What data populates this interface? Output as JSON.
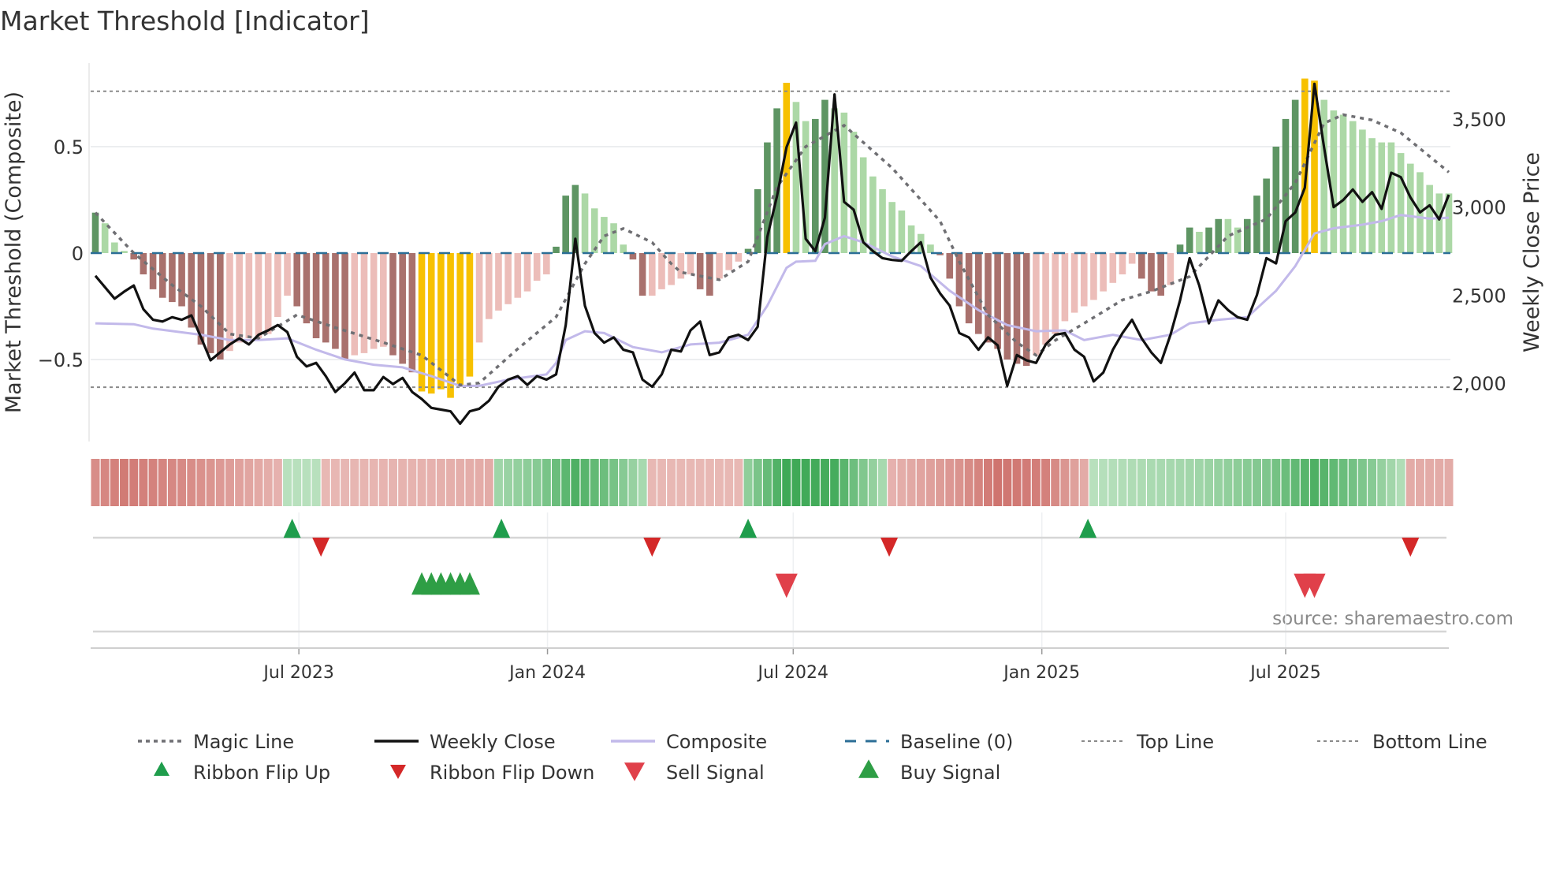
{
  "chart_data": {
    "type": "bar",
    "title": "Market Threshold [Indicator]",
    "ylabel": "Market Threshold (Composite)",
    "y2label": "Weekly Close Price",
    "ylim": [
      -0.75,
      0.85
    ],
    "y2lim": [
      1700,
      3900
    ],
    "yticks": [
      {
        "v": 0.5,
        "label": "0.5"
      },
      {
        "v": 0,
        "label": "0"
      },
      {
        "v": -0.5,
        "label": "−0.5"
      }
    ],
    "y2ticks": [
      {
        "v": 3500,
        "label": "3,500"
      },
      {
        "v": 3000,
        "label": "3,000"
      },
      {
        "v": 2500,
        "label": "2,500"
      },
      {
        "v": 2000,
        "label": "2,000"
      }
    ],
    "xticks": [
      {
        "week": 21.2,
        "label": "Jul 2023"
      },
      {
        "week": 47.1,
        "label": "Jan 2024"
      },
      {
        "week": 72.7,
        "label": "Jul 2024"
      },
      {
        "week": 98.6,
        "label": "Jan 2025"
      },
      {
        "week": 124,
        "label": "Jul 2025"
      }
    ],
    "top_line": 0.76,
    "bottom_line": -0.63,
    "baseline": 0,
    "composite_bars": [
      0.19,
      0.14,
      0.05,
      0.01,
      -0.03,
      -0.1,
      -0.17,
      -0.21,
      -0.23,
      -0.25,
      -0.35,
      -0.43,
      -0.47,
      -0.5,
      -0.46,
      -0.42,
      -0.4,
      -0.4,
      -0.38,
      -0.3,
      -0.2,
      -0.25,
      -0.33,
      -0.4,
      -0.42,
      -0.45,
      -0.5,
      -0.48,
      -0.47,
      -0.45,
      -0.44,
      -0.48,
      -0.52,
      -0.56,
      -0.65,
      -0.66,
      -0.64,
      -0.68,
      -0.62,
      -0.58,
      -0.42,
      -0.31,
      -0.27,
      -0.24,
      -0.21,
      -0.18,
      -0.13,
      -0.1,
      0.03,
      0.27,
      0.32,
      0.28,
      0.21,
      0.17,
      0.14,
      0.04,
      -0.03,
      -0.2,
      -0.2,
      -0.17,
      -0.15,
      -0.12,
      -0.1,
      -0.17,
      -0.2,
      -0.12,
      -0.08,
      -0.04,
      0.02,
      0.3,
      0.52,
      0.68,
      0.8,
      0.71,
      0.62,
      0.63,
      0.72,
      0.68,
      0.66,
      0.57,
      0.45,
      0.36,
      0.3,
      0.24,
      0.2,
      0.13,
      0.09,
      0.04,
      -0.01,
      -0.12,
      -0.25,
      -0.33,
      -0.38,
      -0.42,
      -0.45,
      -0.5,
      -0.52,
      -0.53,
      -0.48,
      -0.43,
      -0.38,
      -0.32,
      -0.28,
      -0.25,
      -0.22,
      -0.18,
      -0.14,
      -0.1,
      -0.05,
      -0.12,
      -0.18,
      -0.2,
      -0.15,
      0.04,
      0.12,
      0.1,
      0.12,
      0.16,
      0.16,
      0.12,
      0.16,
      0.27,
      0.35,
      0.5,
      0.63,
      0.72,
      0.82,
      0.81,
      0.72,
      0.67,
      0.65,
      0.62,
      0.58,
      0.54,
      0.52,
      0.52,
      0.47,
      0.42,
      0.38,
      0.32,
      0.28,
      0.28
    ],
    "weekly_close": [
      2610,
      2545,
      2480,
      2520,
      2555,
      2420,
      2360,
      2350,
      2375,
      2360,
      2385,
      2260,
      2130,
      2175,
      2220,
      2255,
      2220,
      2275,
      2300,
      2330,
      2290,
      2150,
      2095,
      2115,
      2040,
      1950,
      2000,
      2060,
      1960,
      1960,
      2035,
      1995,
      2030,
      1950,
      1910,
      1860,
      1850,
      1840,
      1770,
      1840,
      1855,
      1900,
      1980,
      2020,
      2040,
      1990,
      2040,
      2020,
      2050,
      2330,
      2820,
      2440,
      2285,
      2230,
      2260,
      2190,
      2175,
      2020,
      1980,
      2050,
      2190,
      2180,
      2300,
      2350,
      2160,
      2175,
      2260,
      2275,
      2245,
      2320,
      2830,
      3060,
      3340,
      3480,
      2820,
      2750,
      2940,
      3640,
      3030,
      2985,
      2800,
      2750,
      2710,
      2700,
      2695,
      2750,
      2800,
      2600,
      2510,
      2440,
      2285,
      2260,
      2190,
      2260,
      2215,
      1985,
      2160,
      2130,
      2115,
      2220,
      2275,
      2285,
      2190,
      2150,
      2010,
      2060,
      2190,
      2285,
      2360,
      2255,
      2175,
      2115,
      2275,
      2470,
      2710,
      2555,
      2340,
      2470,
      2415,
      2375,
      2360,
      2500,
      2710,
      2680,
      2920,
      2970,
      3110,
      3700,
      3340,
      3000,
      3040,
      3100,
      3030,
      3085,
      2990,
      3195,
      3170,
      3055,
      2970,
      3010,
      2930,
      3070
    ],
    "composite_line": [
      [
        0,
        2340
      ],
      [
        4,
        2335
      ],
      [
        6,
        2310
      ],
      [
        11,
        2275
      ],
      [
        14,
        2245
      ],
      [
        17,
        2245
      ],
      [
        20,
        2255
      ],
      [
        23,
        2190
      ],
      [
        26,
        2135
      ],
      [
        29,
        2105
      ],
      [
        32,
        2090
      ],
      [
        35,
        2040
      ],
      [
        38,
        1985
      ],
      [
        40,
        1985
      ],
      [
        43,
        2020
      ],
      [
        47,
        2050
      ],
      [
        48,
        2115
      ],
      [
        49,
        2245
      ],
      [
        51,
        2295
      ],
      [
        53,
        2285
      ],
      [
        56,
        2205
      ],
      [
        59,
        2175
      ],
      [
        62,
        2220
      ],
      [
        65,
        2230
      ],
      [
        68,
        2275
      ],
      [
        70,
        2440
      ],
      [
        72,
        2655
      ],
      [
        73,
        2690
      ],
      [
        75,
        2695
      ],
      [
        76,
        2790
      ],
      [
        78,
        2835
      ],
      [
        80,
        2800
      ],
      [
        83,
        2720
      ],
      [
        86,
        2665
      ],
      [
        89,
        2525
      ],
      [
        92,
        2415
      ],
      [
        95,
        2330
      ],
      [
        98,
        2295
      ],
      [
        101,
        2300
      ],
      [
        103,
        2245
      ],
      [
        106,
        2275
      ],
      [
        109,
        2245
      ],
      [
        112,
        2275
      ],
      [
        114,
        2340
      ],
      [
        117,
        2360
      ],
      [
        120,
        2375
      ],
      [
        123,
        2525
      ],
      [
        125,
        2665
      ],
      [
        127,
        2850
      ],
      [
        129,
        2880
      ],
      [
        132,
        2900
      ],
      [
        134,
        2920
      ],
      [
        136,
        2955
      ],
      [
        139,
        2935
      ],
      [
        141,
        2940
      ]
    ],
    "magic_line": [
      [
        0,
        0.19
      ],
      [
        4,
        0
      ],
      [
        8,
        -0.15
      ],
      [
        11,
        -0.25
      ],
      [
        14,
        -0.38
      ],
      [
        17,
        -0.4
      ],
      [
        21,
        -0.29
      ],
      [
        25,
        -0.35
      ],
      [
        30,
        -0.42
      ],
      [
        34,
        -0.48
      ],
      [
        38,
        -0.62
      ],
      [
        40,
        -0.61
      ],
      [
        44,
        -0.45
      ],
      [
        48,
        -0.3
      ],
      [
        51,
        -0.05
      ],
      [
        53,
        0.08
      ],
      [
        55,
        0.115
      ],
      [
        58,
        0.05
      ],
      [
        60,
        -0.05
      ],
      [
        61,
        -0.09
      ],
      [
        65,
        -0.125
      ],
      [
        68,
        -0.04
      ],
      [
        71,
        0.31
      ],
      [
        74,
        0.5
      ],
      [
        78,
        0.6
      ],
      [
        83,
        0.4
      ],
      [
        88,
        0.15
      ],
      [
        90,
        -0.04
      ],
      [
        93,
        -0.29
      ],
      [
        96,
        -0.42
      ],
      [
        98,
        -0.48
      ],
      [
        100,
        -0.41
      ],
      [
        103,
        -0.33
      ],
      [
        107,
        -0.22
      ],
      [
        110,
        -0.18
      ],
      [
        114,
        -0.11
      ],
      [
        118,
        0.08
      ],
      [
        122,
        0.16
      ],
      [
        125,
        0.33
      ],
      [
        128,
        0.61
      ],
      [
        130,
        0.65
      ],
      [
        133,
        0.625
      ],
      [
        136,
        0.565
      ],
      [
        141,
        0.38
      ]
    ],
    "ribbon_strength": [
      [
        0,
        -0.6
      ],
      [
        3,
        -0.75
      ],
      [
        10,
        -0.6
      ],
      [
        19,
        -0.3
      ],
      [
        20,
        0.2
      ],
      [
        23,
        0.2
      ],
      [
        24,
        -0.25
      ],
      [
        35,
        -0.3
      ],
      [
        41,
        -0.35
      ],
      [
        42,
        0.35
      ],
      [
        46,
        0.5
      ],
      [
        50,
        0.85
      ],
      [
        54,
        0.6
      ],
      [
        57,
        0.3
      ],
      [
        58,
        -0.25
      ],
      [
        67,
        -0.25
      ],
      [
        68,
        0.45
      ],
      [
        72,
        0.95
      ],
      [
        77,
        0.9
      ],
      [
        82,
        0.3
      ],
      [
        83,
        -0.3
      ],
      [
        90,
        -0.55
      ],
      [
        94,
        -0.8
      ],
      [
        99,
        -0.7
      ],
      [
        103,
        -0.35
      ],
      [
        104,
        0.2
      ],
      [
        115,
        0.35
      ],
      [
        122,
        0.55
      ],
      [
        127,
        0.85
      ],
      [
        133,
        0.5
      ],
      [
        136,
        0.25
      ],
      [
        137,
        -0.35
      ],
      [
        141,
        -0.35
      ]
    ],
    "ribbon_flip_up": [
      20.5,
      42.3,
      68,
      103.4
    ],
    "ribbon_flip_down": [
      23.5,
      58,
      82.7,
      137
    ],
    "buy_signals": [
      34,
      35,
      36,
      37,
      38,
      39
    ],
    "sell_signals": [
      72,
      126,
      127
    ],
    "legend": [
      {
        "key": "magic",
        "label": "Magic Line"
      },
      {
        "key": "close",
        "label": "Weekly Close"
      },
      {
        "key": "composite",
        "label": "Composite"
      },
      {
        "key": "baseline",
        "label": "Baseline (0)"
      },
      {
        "key": "top",
        "label": "Top Line"
      },
      {
        "key": "bottom",
        "label": "Bottom Line"
      },
      {
        "key": "flipup",
        "label": "Ribbon Flip Up"
      },
      {
        "key": "flipdown",
        "label": "Ribbon Flip Down"
      },
      {
        "key": "sell",
        "label": "Sell Signal"
      },
      {
        "key": "buy",
        "label": "Buy Signal"
      }
    ],
    "legend_placement": "bottom",
    "source": "source: sharemaestro.com",
    "colors": {
      "bar_dark_green": "#5e9563",
      "bar_light_green": "#acd8a6",
      "bar_dark_red": "#a9716d",
      "bar_light_red": "#ecbdb9",
      "bar_extreme": "#f7c100",
      "close": "#111111",
      "composite": "#c2b9ea",
      "magic": "#6f6f73",
      "baseline": "#2b6e96",
      "threshold": "#8a8a8a",
      "flip_up": "#1f9d4c",
      "flip_down": "#d42828",
      "sell": "#e0404a",
      "buy": "#2e9e45"
    }
  }
}
